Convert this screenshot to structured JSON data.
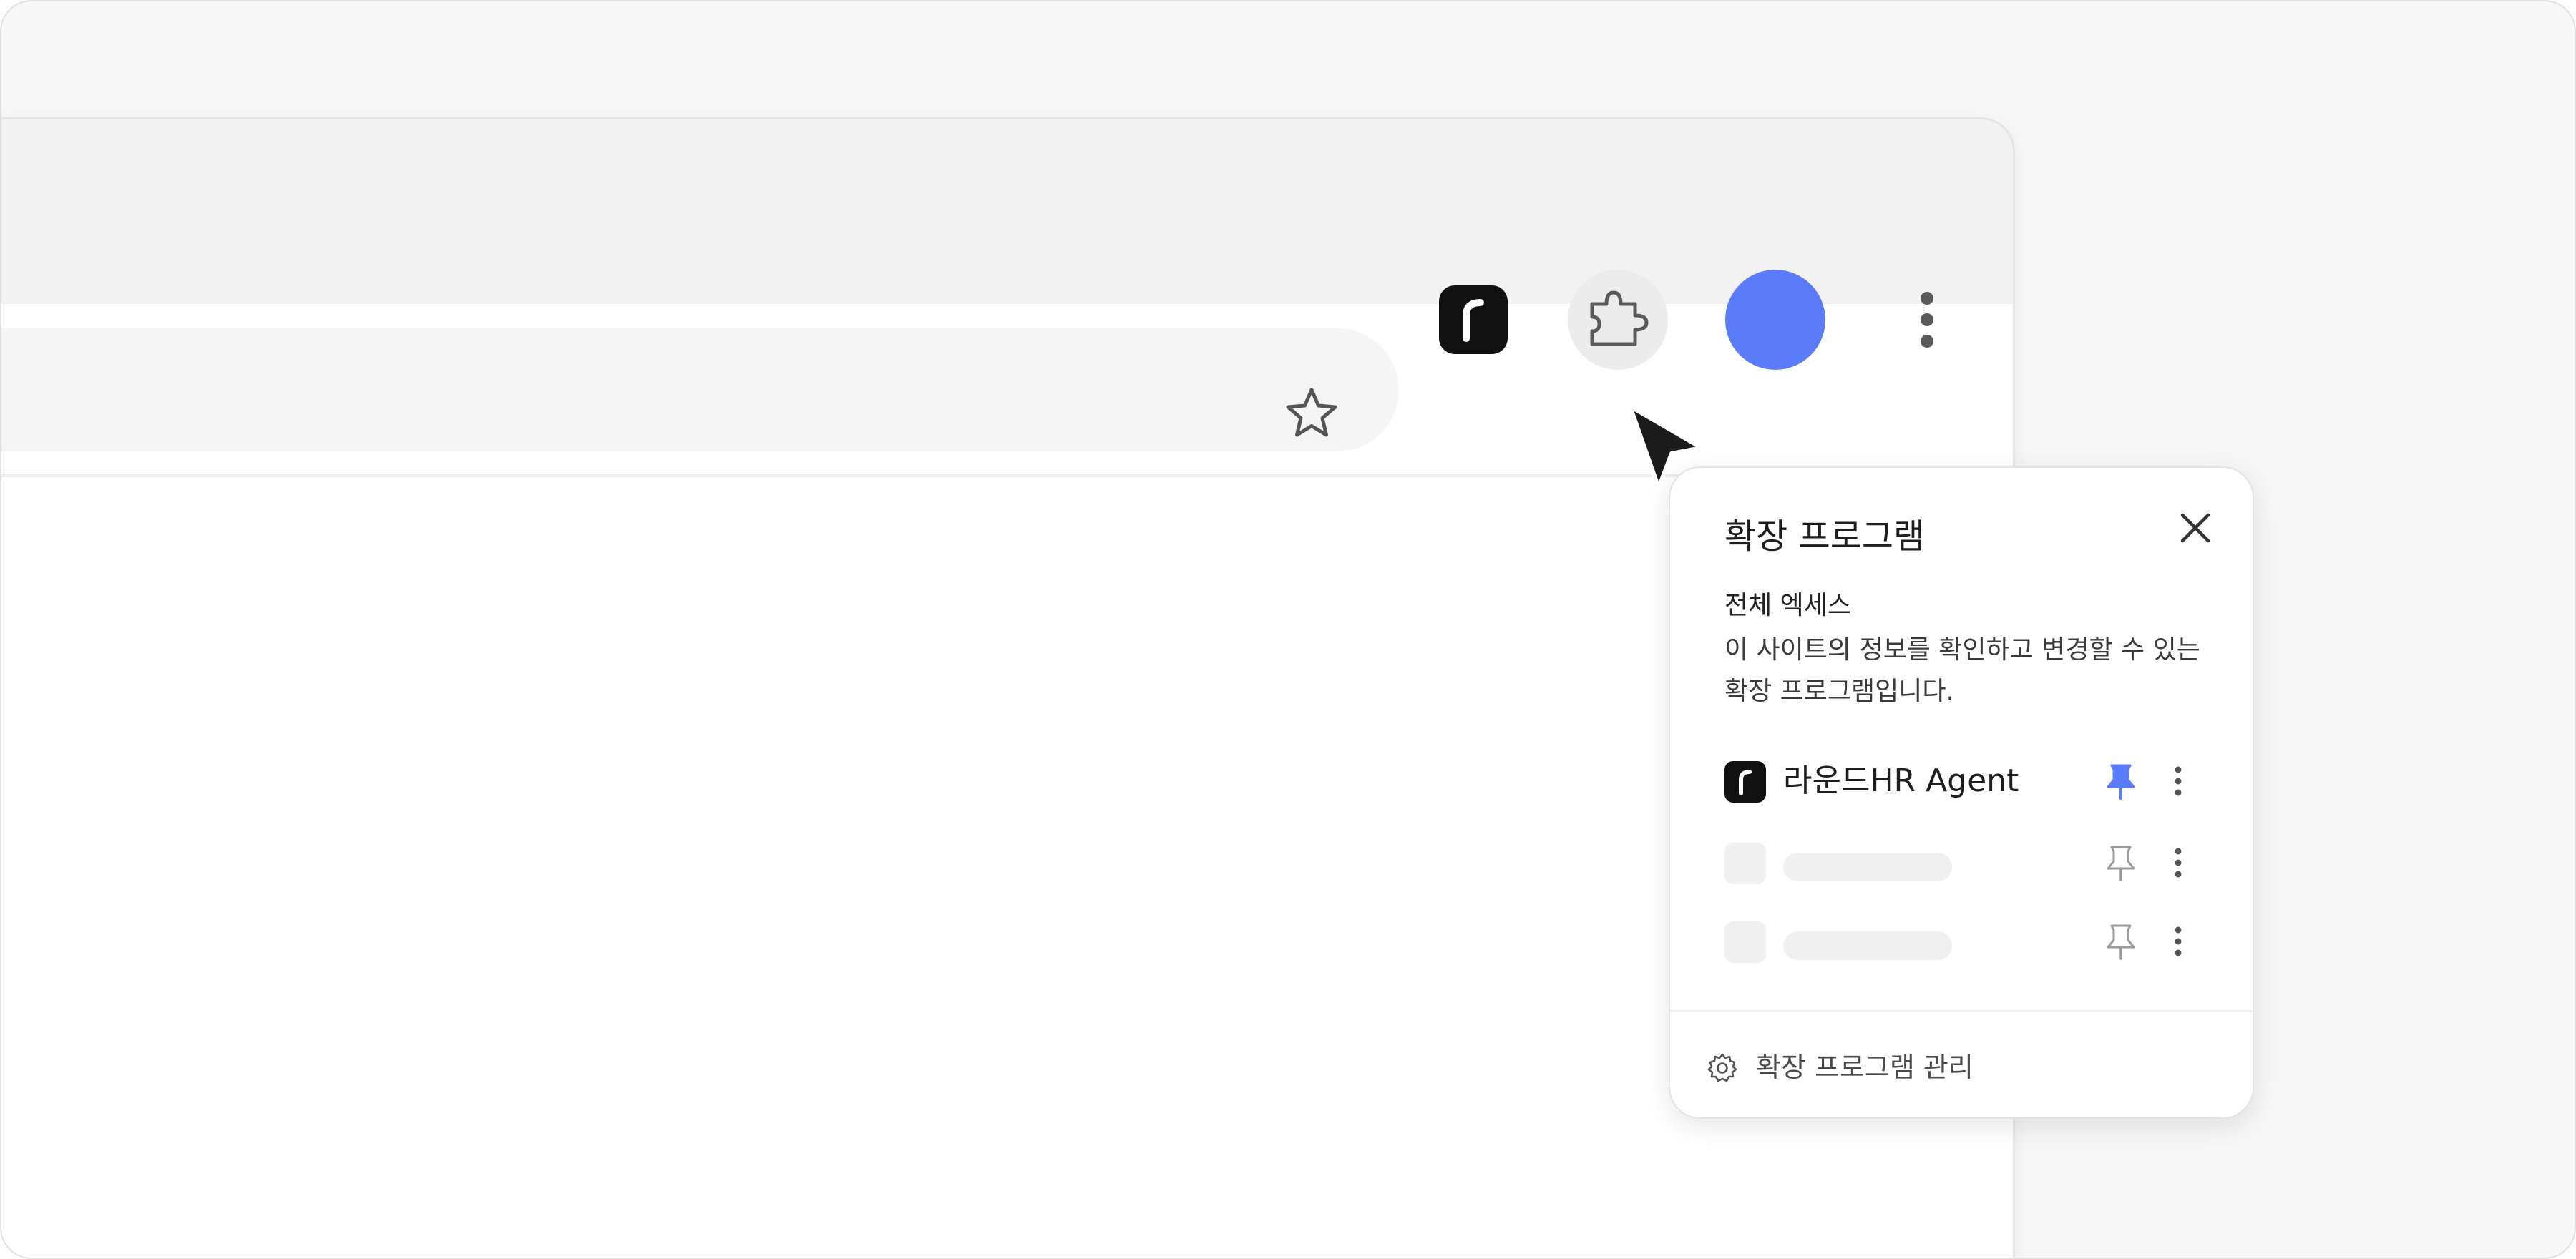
{
  "popup": {
    "title": "확장 프로그램",
    "section_heading": "전체 엑세스",
    "section_description": "이 사이트의 정보를 확인하고 변경할 수 있는 확장 프로그램입니다.",
    "extensions": [
      {
        "name": "라운드HR Agent",
        "pinned": true
      },
      {
        "name": "",
        "pinned": false
      },
      {
        "name": "",
        "pinned": false
      }
    ],
    "manage_label": "확장 프로그램 관리"
  },
  "colors": {
    "accent": "#5b7cfa",
    "extension_icon": "#111111"
  },
  "icons": {
    "bookmark": "star-icon",
    "extensions": "puzzle-icon",
    "menu": "vertical-dots-icon",
    "close": "close-icon",
    "pin": "pin-icon",
    "settings": "gear-icon"
  }
}
